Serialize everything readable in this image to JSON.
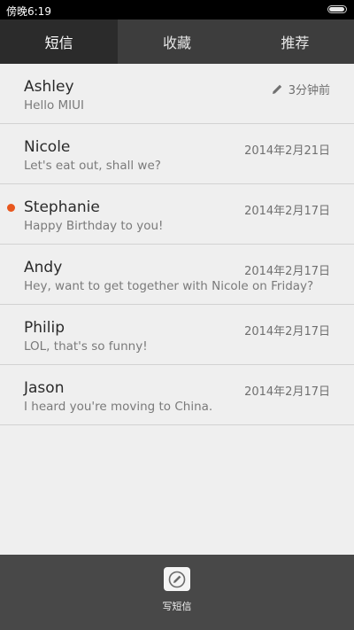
{
  "status_bar": {
    "time": "傍晚6:19",
    "battery_level": 0.95
  },
  "tabs": [
    {
      "label": "短信",
      "active": true
    },
    {
      "label": "收藏",
      "active": false
    },
    {
      "label": "推荐",
      "active": false
    }
  ],
  "messages": [
    {
      "name": "Ashley",
      "preview": "Hello MIUI",
      "time": "3分钟前",
      "draft": true,
      "unread": false
    },
    {
      "name": "Nicole",
      "preview": "Let's eat out, shall we?",
      "time": "2014年2月21日",
      "draft": false,
      "unread": false
    },
    {
      "name": "Stephanie",
      "preview": "Happy Birthday to you!",
      "time": "2014年2月17日",
      "draft": false,
      "unread": true
    },
    {
      "name": "Andy",
      "preview": "Hey, want to get together with Nicole on Friday?",
      "time": "2014年2月17日",
      "draft": false,
      "unread": false
    },
    {
      "name": "Philip",
      "preview": "LOL, that's so funny!",
      "time": "2014年2月17日",
      "draft": false,
      "unread": false
    },
    {
      "name": "Jason",
      "preview": "I heard you're moving to China.",
      "time": "2014年2月17日",
      "draft": false,
      "unread": false
    }
  ],
  "bottom_bar": {
    "compose_label": "写短信",
    "compose_icon": "compose-pen-icon"
  },
  "colors": {
    "unread_dot": "#e8571e",
    "tab_active_bg": "#2b2b2b",
    "tab_bar_bg": "#3d3d3d"
  }
}
